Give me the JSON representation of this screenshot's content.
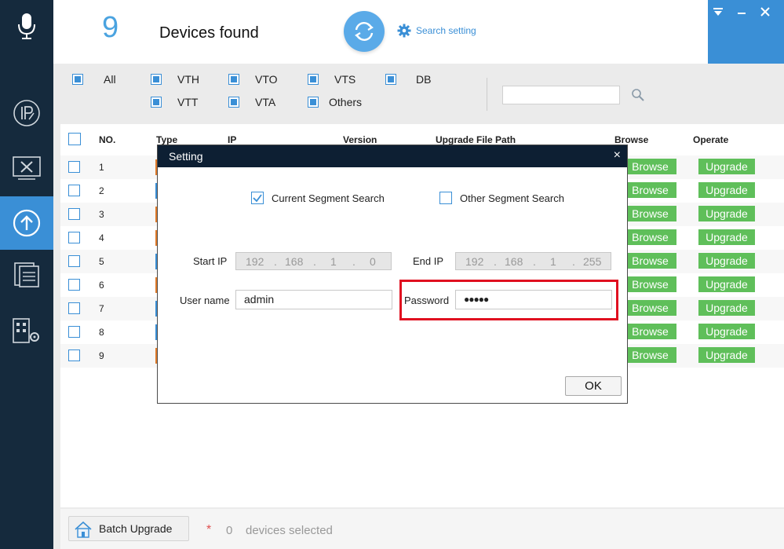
{
  "header": {
    "device_count": "9",
    "devices_found_label": "Devices found",
    "search_setting_label": "Search setting"
  },
  "window_controls": {
    "menu_icon": "menu-down-icon",
    "minimize_icon": "minimize-icon",
    "close_icon": "close-icon"
  },
  "sidebar": {
    "items": [
      {
        "icon": "microphone-icon"
      },
      {
        "icon": "ip-config-icon"
      },
      {
        "icon": "tools-icon"
      },
      {
        "icon": "upgrade-icon",
        "active": true
      },
      {
        "icon": "document-list-icon"
      },
      {
        "icon": "building-settings-icon"
      }
    ]
  },
  "filter": {
    "items": [
      {
        "label": "All"
      },
      {
        "label": "VTH"
      },
      {
        "label": "VTO"
      },
      {
        "label": "VTS"
      },
      {
        "label": "DB"
      },
      {
        "label": "VTT"
      },
      {
        "label": "VTA"
      },
      {
        "label": "Others"
      }
    ],
    "search_value": ""
  },
  "table": {
    "headers": {
      "no": "NO.",
      "type": "Type",
      "ip": "IP",
      "version": "Version",
      "upgrade_path": "Upgrade File Path",
      "browse": "Browse",
      "operate": "Operate"
    },
    "rows": [
      {
        "no": "1",
        "browse": "Browse",
        "upgrade": "Upgrade",
        "type_color": "#e07b2a"
      },
      {
        "no": "2",
        "browse": "Browse",
        "upgrade": "Upgrade",
        "type_color": "#3a8fd6"
      },
      {
        "no": "3",
        "browse": "Browse",
        "upgrade": "Upgrade",
        "type_color": "#e07b2a"
      },
      {
        "no": "4",
        "browse": "Browse",
        "upgrade": "Upgrade",
        "type_color": "#e07b2a"
      },
      {
        "no": "5",
        "browse": "Browse",
        "upgrade": "Upgrade",
        "type_color": "#3a8fd6"
      },
      {
        "no": "6",
        "browse": "Browse",
        "upgrade": "Upgrade",
        "type_color": "#e07b2a"
      },
      {
        "no": "7",
        "browse": "Browse",
        "upgrade": "Upgrade",
        "type_color": "#3a8fd6"
      },
      {
        "no": "8",
        "browse": "Browse",
        "upgrade": "Upgrade",
        "type_color": "#3a8fd6"
      },
      {
        "no": "9",
        "browse": "Browse",
        "upgrade": "Upgrade",
        "type_color": "#e07b2a"
      }
    ]
  },
  "footer": {
    "batch_upgrade_label": "Batch Upgrade",
    "star": "*",
    "selected_count": "0",
    "selected_label": "devices selected"
  },
  "dialog": {
    "title": "Setting",
    "close": "×",
    "current_segment_label": "Current Segment Search",
    "current_segment_checked": true,
    "other_segment_label": "Other Segment Search",
    "other_segment_checked": false,
    "start_ip_label": "Start IP",
    "start_ip": [
      "192",
      "168",
      "1",
      "0"
    ],
    "end_ip_label": "End IP",
    "end_ip": [
      "192",
      "168",
      "1",
      "255"
    ],
    "username_label": "User name",
    "username_value": "admin",
    "password_label": "Password",
    "password_value": "●●●●●",
    "ok_label": "OK"
  },
  "colors": {
    "sidebar_bg": "#152a3d",
    "accent": "#3a8fd6",
    "button_green": "#5fbf5a",
    "highlight_red": "#e01020"
  }
}
